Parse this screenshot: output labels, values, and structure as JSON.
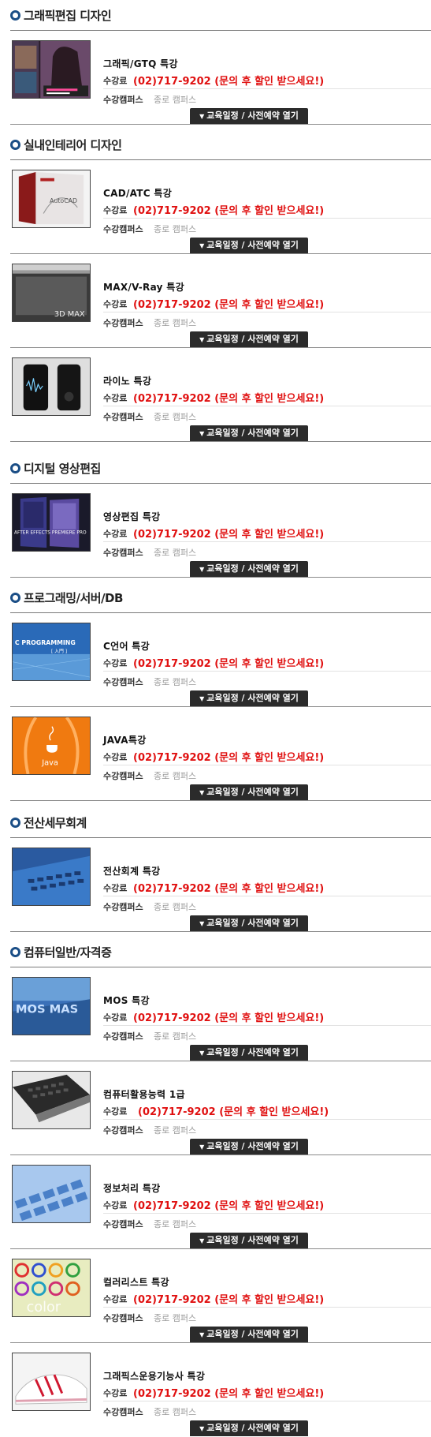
{
  "common": {
    "fee_label": "수강료",
    "campus_label": "수강캠퍼스",
    "campus_value": "종로 캠퍼스",
    "phone_text": "(02)717-9202 (문의 후 할인 받으세요!)",
    "button_label": "교육일정 / 사전예약 열기",
    "accent_color": "#e01010",
    "bullet_color": "#1b4e86",
    "button_color": "#2b2b2b"
  },
  "sections": [
    {
      "title": "그래픽편집 디자인",
      "courses": [
        {
          "name": "그래픽/GTQ 특강",
          "thumb_text": "",
          "icon": "magazine-cover-thumbnail"
        }
      ]
    },
    {
      "title": "실내인테리어 디자인",
      "courses": [
        {
          "name": "CAD/ATC 특강",
          "thumb_text": "AutoCAD",
          "icon": "autocad-box-thumbnail"
        },
        {
          "name": "MAX/V-Ray 특강",
          "thumb_text": "3D MAX",
          "icon": "3dmax-screen-thumbnail"
        },
        {
          "name": "라이노 특강",
          "thumb_text": "",
          "icon": "phone-device-thumbnail"
        }
      ]
    },
    {
      "title": "디지털 영상편집",
      "courses": [
        {
          "name": "영상편집 특강",
          "thumb_text": "AFTER EFFECTS  PREMIERE PRO",
          "icon": "software-boxes-thumbnail"
        }
      ]
    },
    {
      "title": "프로그래밍/서버/DB",
      "courses": [
        {
          "name": "C언어 특강",
          "thumb_text": "C PROGRAMMING",
          "thumb_text2": "[ 入門 ]",
          "icon": "c-programming-thumbnail"
        },
        {
          "name": "JAVA특강",
          "thumb_text": "Java",
          "icon": "java-logo-thumbnail"
        }
      ]
    },
    {
      "title": "전산세무회계",
      "courses": [
        {
          "name": "전산회계 특강",
          "thumb_text": "",
          "icon": "keyboard-thumbnail"
        }
      ]
    },
    {
      "title": "컴퓨터일반/자격증",
      "courses": [
        {
          "name": "MOS 특강",
          "thumb_text": "MOS MAS",
          "icon": "mos-thumbnail"
        },
        {
          "name": "컴퓨터활용능력 1급",
          "thumb_text": "",
          "icon": "laptop-thumbnail"
        },
        {
          "name": "정보처리 특강",
          "thumb_text": "",
          "icon": "blue-keys-thumbnail"
        },
        {
          "name": "컬러리스트 특강",
          "thumb_text": "color",
          "icon": "color-wheels-thumbnail"
        },
        {
          "name": "그래픽스운용기능사 특강",
          "thumb_text": "",
          "icon": "sneaker-thumbnail"
        }
      ]
    }
  ]
}
